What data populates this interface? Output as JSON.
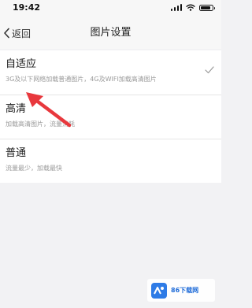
{
  "status_bar": {
    "time": "19:42"
  },
  "nav": {
    "back_label": "返回",
    "title": "图片设置"
  },
  "options": [
    {
      "title": "自适应",
      "desc": "3G及以下网络加载普通图片，4G及WIFI加载高清图片",
      "selected": true
    },
    {
      "title": "高清",
      "desc": "加载高清图片，流量消耗",
      "selected": false
    },
    {
      "title": "普通",
      "desc": "流量最少，加载最快",
      "selected": false
    }
  ],
  "colors": {
    "arrow": "#e8383d",
    "accent": "#2e7be6"
  },
  "watermark": {
    "text": "86下载网",
    "logo": "86-logo"
  }
}
